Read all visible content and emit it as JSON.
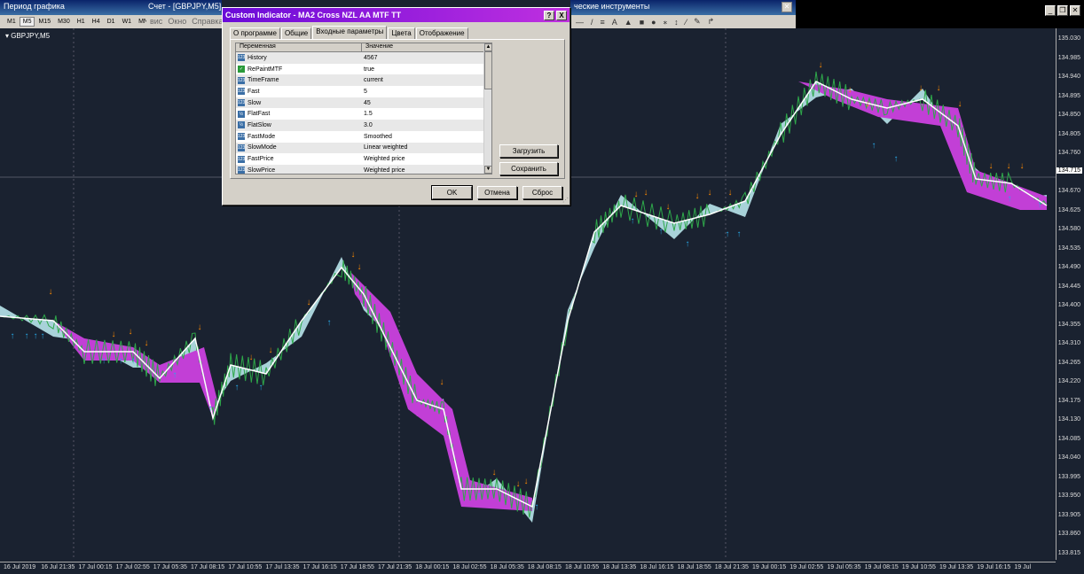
{
  "window": {
    "title_left": "Период графика",
    "title_chart": "Счет - [GBPJPY,M5]",
    "title_tools": "ческие инструменты"
  },
  "timeframes": [
    "M1",
    "M5",
    "M15",
    "M30",
    "H1",
    "H4",
    "D1",
    "W1",
    "MN"
  ],
  "active_timeframe": "M5",
  "menu": [
    "вис",
    "Окно",
    "Справка"
  ],
  "tools": [
    "—",
    "/",
    "≡",
    "A",
    "▲",
    "■",
    "●",
    "⁎",
    "↕",
    "⁄",
    "✎",
    "↱"
  ],
  "chart": {
    "symbol": "GBPJPY,M5",
    "current_price": "134.715",
    "y_labels": [
      "135.030",
      "134.985",
      "134.940",
      "134.895",
      "134.850",
      "134.805",
      "134.760",
      "134.715",
      "134.670",
      "134.625",
      "134.580",
      "134.535",
      "134.490",
      "134.445",
      "134.400",
      "134.355",
      "134.310",
      "134.265",
      "134.220",
      "134.175",
      "134.130",
      "134.085",
      "134.040",
      "133.995",
      "133.950",
      "133.905",
      "133.860",
      "133.815"
    ],
    "x_labels": [
      "16 Jul 2019",
      "16 Jul 21:35",
      "17 Jul 00:15",
      "17 Jul 02:55",
      "17 Jul 05:35",
      "17 Jul 08:15",
      "17 Jul 10:55",
      "17 Jul 13:35",
      "17 Jul 16:15",
      "17 Jul 18:55",
      "17 Jul 21:35",
      "18 Jul 00:15",
      "18 Jul 02:55",
      "18 Jul 05:35",
      "18 Jul 08:15",
      "18 Jul 10:55",
      "18 Jul 13:35",
      "18 Jul 16:15",
      "18 Jul 18:55",
      "18 Jul 21:35",
      "19 Jul 00:15",
      "19 Jul 02:55",
      "19 Jul 05:35",
      "19 Jul 08:15",
      "19 Jul 10:55",
      "19 Jul 13:35",
      "19 Jul 16:15",
      "19 Jul"
    ],
    "colors": {
      "bg": "#1a2230",
      "price": "#2ea84a",
      "up_fill": "#b8e6ec",
      "down_fill": "#c23fd6",
      "line": "#ffffff",
      "up_arrow": "#28a8e6",
      "down_arrow": "#ff8a00"
    }
  },
  "dialog": {
    "title": "Custom Indicator - MA2 Cross NZL AA MTF TT",
    "help": "?",
    "close": "X",
    "tabs": [
      "О программе",
      "Общие",
      "Входные параметры",
      "Цвета",
      "Отображение"
    ],
    "active_tab": "Входные параметры",
    "columns": [
      "Переменная",
      "Значение"
    ],
    "params": [
      {
        "name": "History",
        "value": "4567",
        "icon": "123"
      },
      {
        "name": "RePaintMTF",
        "value": "true",
        "icon": "bool"
      },
      {
        "name": "TimeFrame",
        "value": "current",
        "icon": "123"
      },
      {
        "name": "Fast",
        "value": "5",
        "icon": "123"
      },
      {
        "name": "Slow",
        "value": "45",
        "icon": "123"
      },
      {
        "name": "FlatFast",
        "value": "1.5",
        "icon": "1/2"
      },
      {
        "name": "FlatSlow",
        "value": "3.0",
        "icon": "1/2"
      },
      {
        "name": "FastMode",
        "value": "Smoothed",
        "icon": "123"
      },
      {
        "name": "SlowMode",
        "value": "Linear weighted",
        "icon": "123"
      },
      {
        "name": "FastPrice",
        "value": "Weighted price",
        "icon": "123"
      },
      {
        "name": "SlowPrice",
        "value": "Weighted price",
        "icon": "123"
      }
    ],
    "load_button": "Загрузить",
    "save_button": "Сохранить",
    "ok_button": "OK",
    "cancel_button": "Отмена",
    "reset_button": "Сброс"
  }
}
